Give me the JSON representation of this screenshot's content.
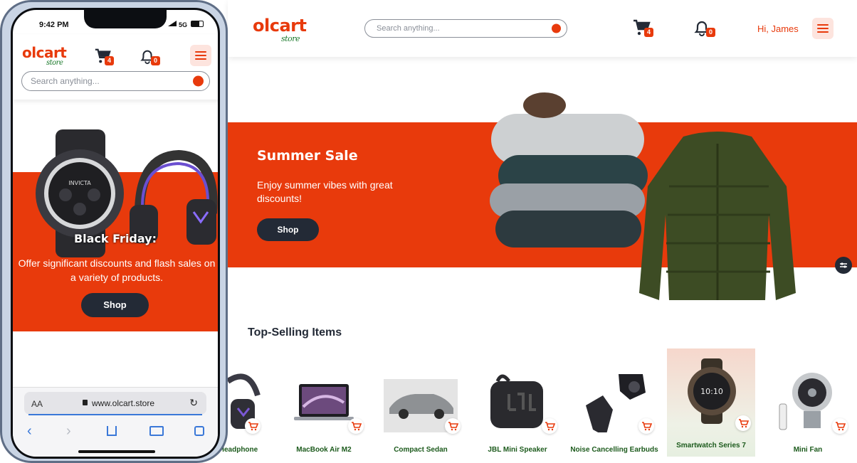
{
  "desktop": {
    "logo": {
      "brand": "olcart",
      "sub": "store"
    },
    "search": {
      "placeholder": "Search anything..."
    },
    "cart_count": "4",
    "notification_count": "0",
    "greeting": "Hi, James",
    "banner": {
      "title": "Summer Sale",
      "description": "Enjoy summer vibes with great discounts!",
      "shop_label": "Shop"
    },
    "section_title": "Top-Selling Items",
    "products": [
      {
        "name": "Headphone"
      },
      {
        "name": "MacBook Air M2"
      },
      {
        "name": "Compact Sedan"
      },
      {
        "name": "JBL Mini Speaker"
      },
      {
        "name": "Noise Cancelling Earbuds"
      },
      {
        "name": "Smartwatch Series 7"
      },
      {
        "name": "Mini Fan"
      }
    ]
  },
  "mobile": {
    "status_time": "9:42 PM",
    "status_network": "5G",
    "logo": {
      "brand": "olcart",
      "sub": "store"
    },
    "cart_count": "4",
    "notification_count": "0",
    "search": {
      "placeholder": "Search anything..."
    },
    "banner": {
      "title": "Black Friday:",
      "description": "Offer significant discounts and flash sales on a variety of products.",
      "shop_label": "Shop"
    },
    "browser": {
      "text_size": "AA",
      "url": "www.olcart.store"
    },
    "watch_brand": "INVICTA"
  },
  "colors": {
    "accent": "#e83a0c",
    "dark": "#232a36",
    "green": "#1c7a2c"
  }
}
